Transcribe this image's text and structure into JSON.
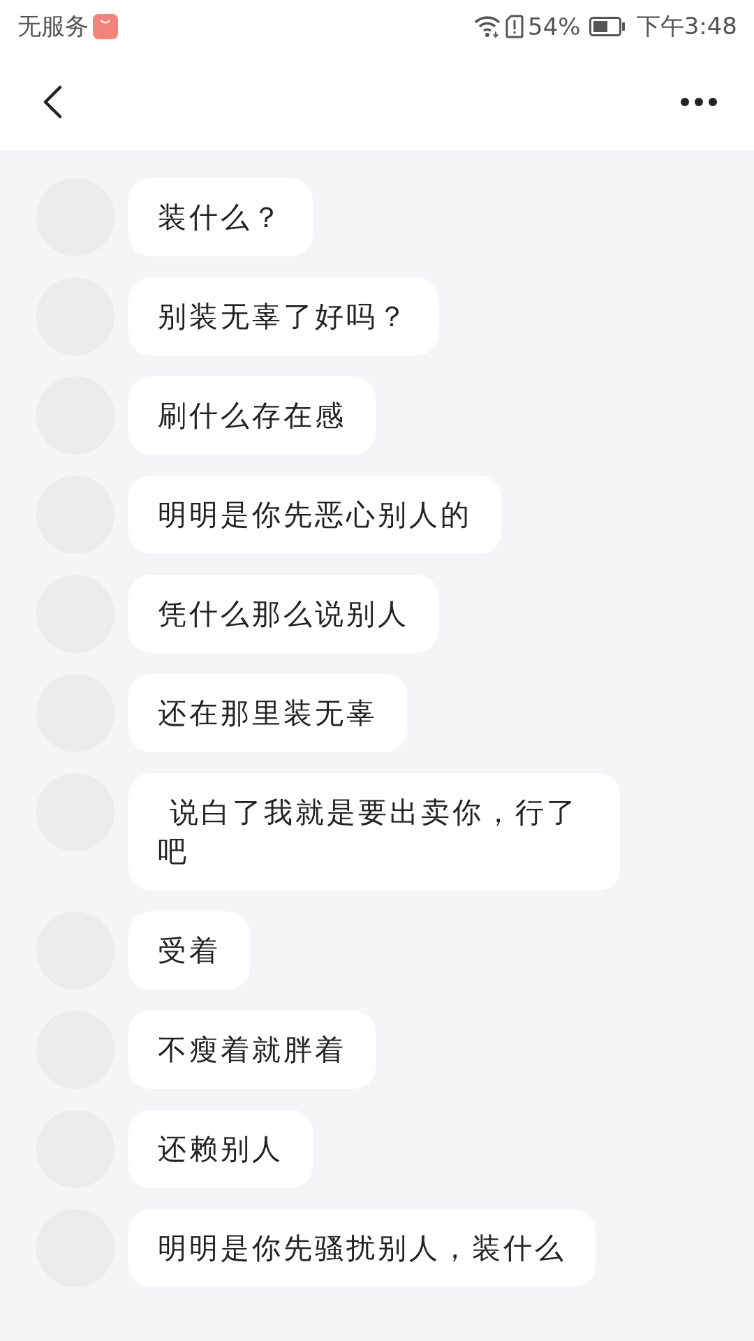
{
  "status_bar": {
    "carrier": "无服务",
    "battery_percent": "54%",
    "time": "下午3:48"
  },
  "messages": [
    {
      "text": "装什么？"
    },
    {
      "text": "别装无辜了好吗？"
    },
    {
      "text": "刷什么存在感"
    },
    {
      "text": "明明是你先恶心别人的"
    },
    {
      "text": "凭什么那么说别人"
    },
    {
      "text": "还在那里装无辜"
    },
    {
      "text": " 说白了我就是要出卖你，行了吧"
    },
    {
      "text": "受着"
    },
    {
      "text": "不瘦着就胖着"
    },
    {
      "text": "还赖别人"
    },
    {
      "text": "明明是你先骚扰别人，装什么"
    }
  ]
}
